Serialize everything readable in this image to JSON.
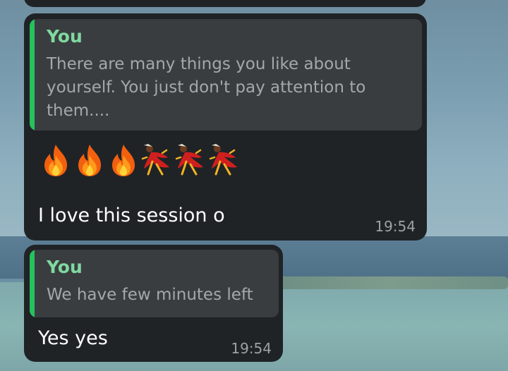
{
  "messages": [
    {
      "quote_author": "You",
      "quote_text": "There are many things you like about yourself. You just don't pay attention to them....",
      "emojis": [
        "fire",
        "fire",
        "fire",
        "dancer",
        "dancer",
        "dancer"
      ],
      "text": "I love this session o",
      "time": "19:54"
    },
    {
      "quote_author": "You",
      "quote_text": "We have few minutes left",
      "text": "Yes yes",
      "time": "19:54"
    }
  ],
  "colors": {
    "bubble": "#1f2326",
    "quote_bg": "#3a3d40",
    "quote_bar": "#25c15d",
    "quote_author": "#7fd9a0"
  }
}
